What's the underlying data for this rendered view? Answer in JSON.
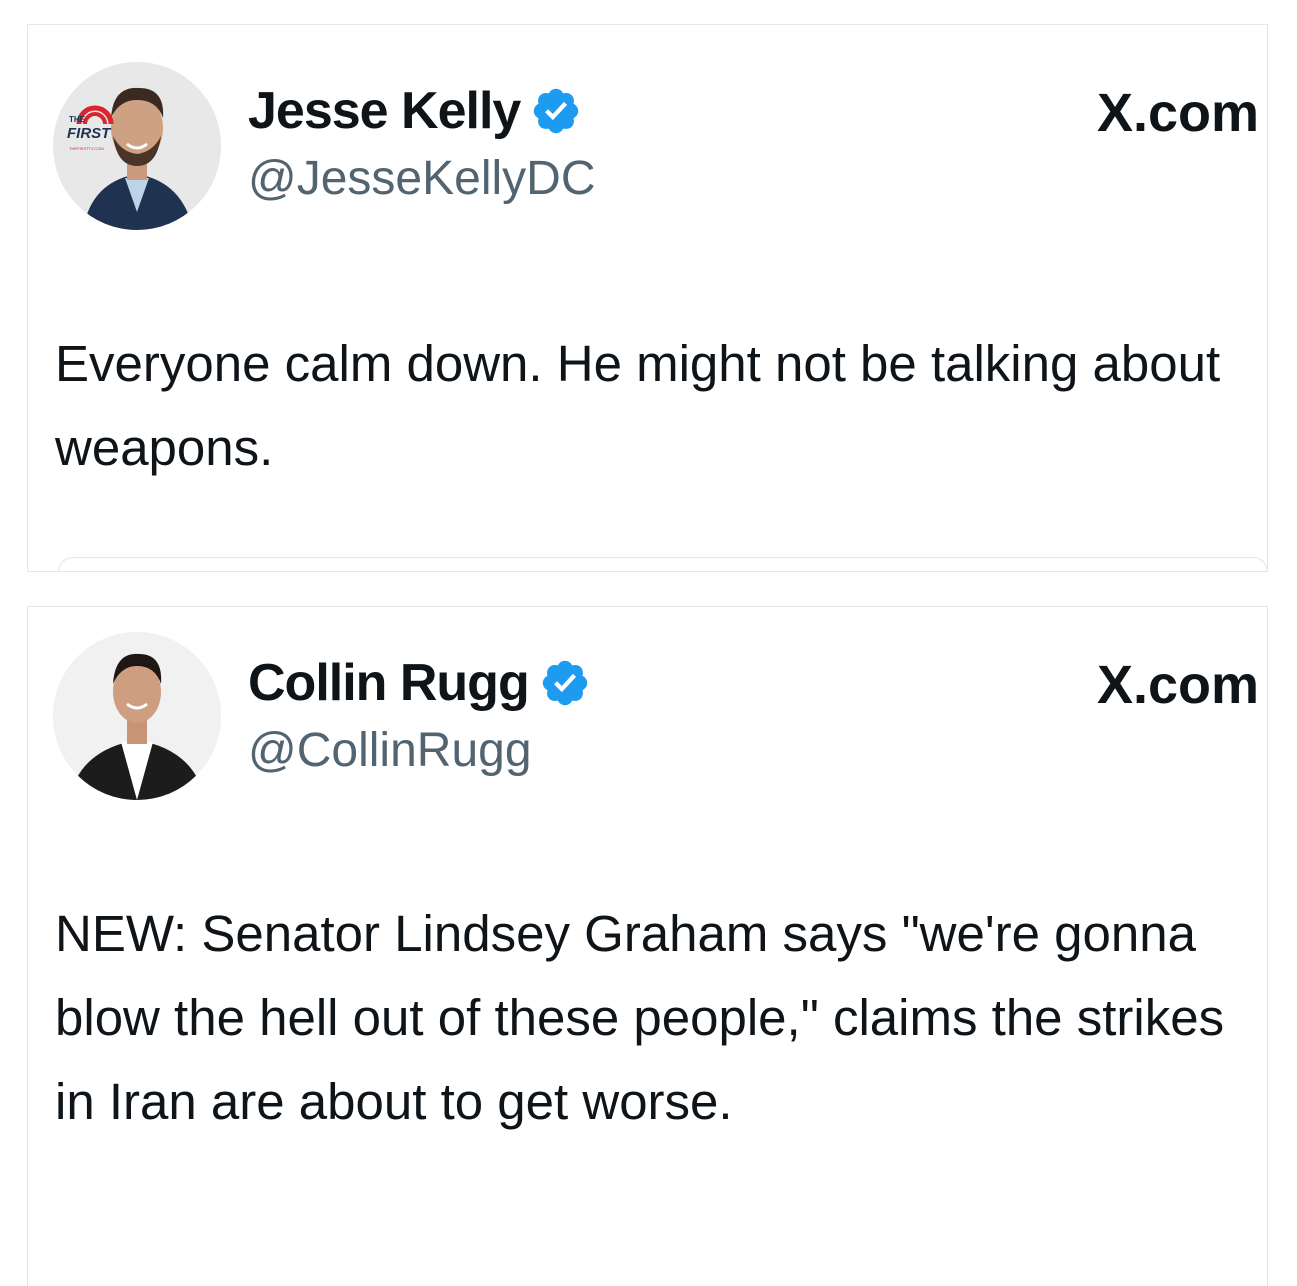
{
  "tweets": [
    {
      "author": {
        "name": "Jesse Kelly",
        "handle": "@JesseKellyDC",
        "verified": true,
        "avatar_icon": "jesse-kelly-avatar",
        "avatar_logo_text": "THE FIRST",
        "avatar_logo_subtext": "THEFIRSTTV.COM"
      },
      "site_label": "X.com",
      "text": "Everyone calm down. He might not be talking about weapons."
    },
    {
      "author": {
        "name": "Collin Rugg",
        "handle": "@CollinRugg",
        "verified": true,
        "avatar_icon": "collin-rugg-avatar"
      },
      "site_label": "X.com",
      "text": "NEW: Senator Lindsey Graham says \"we're gonna blow the hell out of these people,\" claims the strikes in Iran are about to get worse."
    }
  ],
  "colors": {
    "text_primary": "#0f1419",
    "text_secondary": "#536471",
    "verified_blue": "#1d9bf0",
    "card_border": "#e6e6e6",
    "logo_red": "#d9262e"
  }
}
